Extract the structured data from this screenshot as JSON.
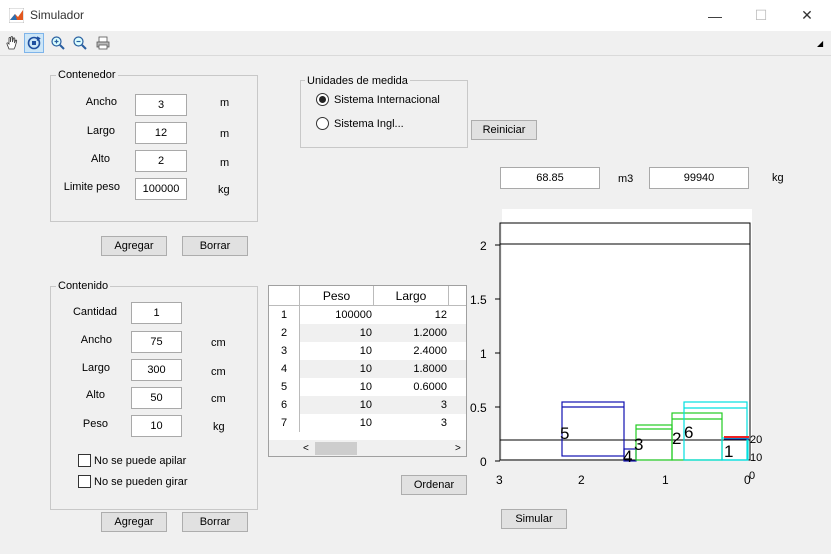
{
  "window": {
    "title": "Simulador",
    "minimize": "—",
    "maximize": "☐",
    "close": "✕"
  },
  "toolbar": {
    "tools": [
      {
        "name": "pan-hand-icon",
        "glyph": "✋"
      },
      {
        "name": "rotate-3d-icon",
        "glyph": "↻"
      },
      {
        "name": "zoom-in-icon",
        "glyph": "⊕"
      },
      {
        "name": "zoom-out-icon",
        "glyph": "⊖"
      },
      {
        "name": "print-icon",
        "glyph": "⎙"
      }
    ],
    "menu_arrow": "◢"
  },
  "contenedor": {
    "title": "Contenedor",
    "ancho_label": "Ancho",
    "ancho_value": "3",
    "ancho_unit": "m",
    "largo_label": "Largo",
    "largo_value": "12",
    "largo_unit": "m",
    "alto_label": "Alto",
    "alto_value": "2",
    "alto_unit": "m",
    "limite_label": "Limite peso",
    "limite_value": "100000",
    "limite_unit": "kg",
    "agregar": "Agregar",
    "borrar": "Borrar"
  },
  "unidades": {
    "title": "Unidades de medida",
    "option_si": "Sistema Internacional",
    "option_ingl": "Sistema Ingl...",
    "selected": "si",
    "reiniciar": "Reiniciar"
  },
  "totals": {
    "volume": "68.85",
    "volume_unit": "m3",
    "weight": "99940",
    "weight_unit": "kg"
  },
  "contenido": {
    "title": "Contenido",
    "cantidad_label": "Cantidad",
    "cantidad_value": "1",
    "ancho_label": "Ancho",
    "ancho_value": "75",
    "ancho_unit": "cm",
    "largo_label": "Largo",
    "largo_value": "300",
    "largo_unit": "cm",
    "alto_label": "Alto",
    "alto_value": "50",
    "alto_unit": "cm",
    "peso_label": "Peso",
    "peso_value": "10",
    "peso_unit": "kg",
    "no_apilar": "No se puede apilar",
    "no_girar": "No se pueden girar",
    "agregar": "Agregar",
    "borrar": "Borrar"
  },
  "table": {
    "columns": [
      "Peso",
      "Largo"
    ],
    "rows": [
      {
        "n": "1",
        "peso": "100000",
        "largo": "12"
      },
      {
        "n": "2",
        "peso": "10",
        "largo": "1.2000"
      },
      {
        "n": "3",
        "peso": "10",
        "largo": "2.4000"
      },
      {
        "n": "4",
        "peso": "10",
        "largo": "1.8000"
      },
      {
        "n": "5",
        "peso": "10",
        "largo": "0.6000"
      },
      {
        "n": "6",
        "peso": "10",
        "largo": "3"
      },
      {
        "n": "7",
        "peso": "10",
        "largo": "3"
      }
    ],
    "scroll_left": "<",
    "scroll_right": ">"
  },
  "ordenar": "Ordenar",
  "simular": "Simular",
  "chart_data": {
    "type": "3d-boxes",
    "zticks": [
      "0",
      "0.5",
      "1",
      "1.5",
      "2"
    ],
    "xticks": [
      "3",
      "2",
      "1",
      "0"
    ],
    "yticks": [
      "0",
      "10",
      "20"
    ],
    "box_labels": [
      "1",
      "2",
      "3",
      "4",
      "5",
      "6"
    ],
    "colors": {
      "box5": "#1010b0",
      "box4": "#1010b0",
      "box3": "#22cc22",
      "box2": "#22cc22",
      "box6": "#00e0e0",
      "box1": "#00e0e0",
      "marker": "#ee2222"
    }
  }
}
